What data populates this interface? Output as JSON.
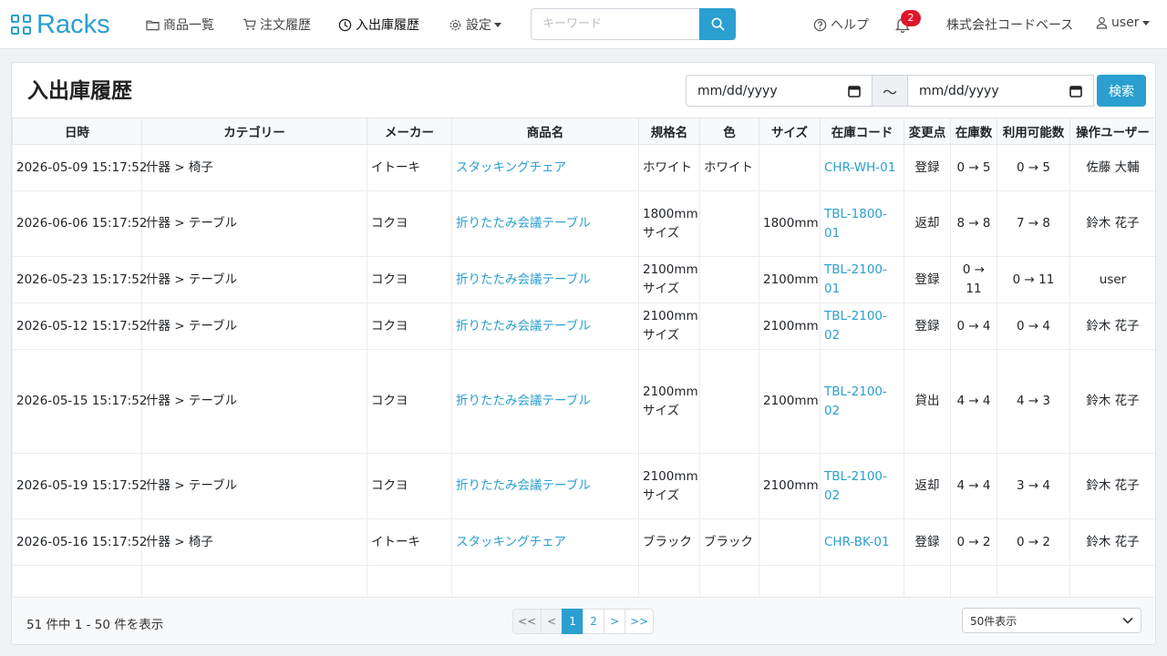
{
  "brand": {
    "name": "Racks"
  },
  "nav": {
    "products": "商品一覧",
    "orders": "注文履歴",
    "inout": "入出庫履歴",
    "settings": "設定",
    "help": "ヘルプ",
    "company": "株式会社コードベース",
    "user": "user",
    "notification_count": "2"
  },
  "search": {
    "placeholder": "キーワード"
  },
  "page": {
    "title": "入出庫履歴"
  },
  "filter": {
    "date_from": "mm/dd/yyyy",
    "separator": "〜",
    "date_to": "mm/dd/yyyy",
    "search_label": "検索"
  },
  "table": {
    "headers": [
      "日時",
      "カテゴリー",
      "メーカー",
      "商品名",
      "規格名",
      "色",
      "サイズ",
      "在庫コード",
      "変更点",
      "在庫数",
      "利用可能数",
      "操作ユーザー"
    ],
    "rows": [
      {
        "datetime": "2026-05-09 15:17:52",
        "category": "什器 > 椅子",
        "maker": "イトーキ",
        "product": "スタッキングチェア",
        "spec": "ホワイト",
        "color": "ホワイト",
        "size": "",
        "code": "CHR-WH-01",
        "change": "登録",
        "stock": "0 → 5",
        "available": "0 → 5",
        "user": "佐藤 大輔"
      },
      {
        "datetime": "2026-06-06 15:17:52",
        "category": "什器 > テーブル",
        "maker": "コクヨ",
        "product": "折りたたみ会議テーブル",
        "spec": "1800mm サイズ",
        "color": "",
        "size": "1800mm",
        "code": "TBL-1800-01",
        "change": "返却",
        "stock": "8 → 8",
        "available": "7 → 8",
        "user": "鈴木 花子"
      },
      {
        "datetime": "2026-05-23 15:17:52",
        "category": "什器 > テーブル",
        "maker": "コクヨ",
        "product": "折りたたみ会議テーブル",
        "spec": "2100mm サイズ",
        "color": "",
        "size": "2100mm",
        "code": "TBL-2100-01",
        "change": "登録",
        "stock": "0 → 11",
        "available": "0 → 11",
        "user": "user"
      },
      {
        "datetime": "2026-05-12 15:17:52",
        "category": "什器 > テーブル",
        "maker": "コクヨ",
        "product": "折りたたみ会議テーブル",
        "spec": "2100mm サイズ",
        "color": "",
        "size": "2100mm",
        "code": "TBL-2100-02",
        "change": "登録",
        "stock": "0 → 4",
        "available": "0 → 4",
        "user": "鈴木 花子"
      },
      {
        "datetime": "2026-05-15 15:17:52",
        "category": "什器 > テーブル",
        "maker": "コクヨ",
        "product": "折りたたみ会議テーブル",
        "spec": "2100mm サイズ",
        "color": "",
        "size": "2100mm",
        "code": "TBL-2100-02",
        "change": "貸出",
        "stock": "4 → 4",
        "available": "4 → 3",
        "user": "鈴木 花子"
      },
      {
        "datetime": "2026-05-19 15:17:52",
        "category": "什器 > テーブル",
        "maker": "コクヨ",
        "product": "折りたたみ会議テーブル",
        "spec": "2100mm サイズ",
        "color": "",
        "size": "2100mm",
        "code": "TBL-2100-02",
        "change": "返却",
        "stock": "4 → 4",
        "available": "3 → 4",
        "user": "鈴木 花子"
      },
      {
        "datetime": "2026-05-16 15:17:52",
        "category": "什器 > 椅子",
        "maker": "イトーキ",
        "product": "スタッキングチェア",
        "spec": "ブラック",
        "color": "ブラック",
        "size": "",
        "code": "CHR-BK-01",
        "change": "登録",
        "stock": "0 → 2",
        "available": "0 → 2",
        "user": "鈴木 花子"
      }
    ]
  },
  "footer": {
    "count_text": "51 件中 1 - 50 件を表示",
    "pager": {
      "first": "<<",
      "prev": "<",
      "p1": "1",
      "p2": "2",
      "next": ">",
      "last": ">>"
    },
    "per_page": "50件表示"
  },
  "colors": {
    "accent": "#2a9fd0",
    "badge": "#e0152b"
  }
}
